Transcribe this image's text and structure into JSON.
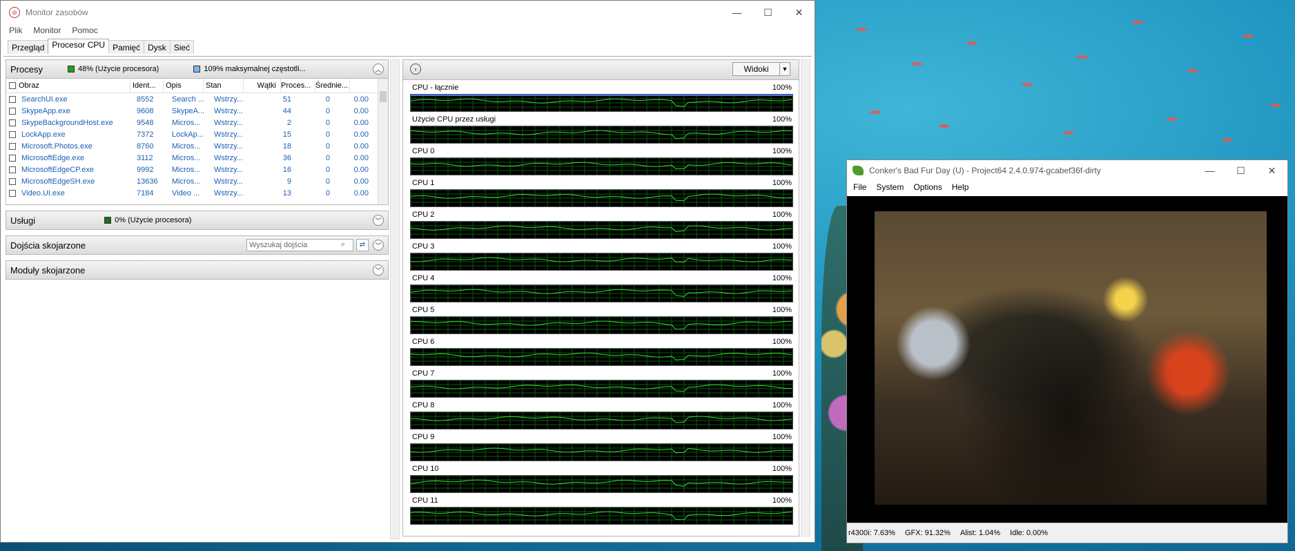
{
  "rm": {
    "title": "Monitor zasobów",
    "menu": [
      "Plik",
      "Monitor",
      "Pomoc"
    ],
    "tabs": [
      "Przegląd",
      "Procesor CPU",
      "Pamięć",
      "Dysk",
      "Sieć"
    ],
    "active_tab": "Procesor CPU",
    "processes": {
      "title": "Procesy",
      "cpu_usage": "48% (Użycie procesora)",
      "max_freq": "109% maksymalnej częstotli...",
      "columns": [
        "Obraz",
        "Ident...",
        "Opis",
        "Stan",
        "Wątki",
        "Proces...",
        "Średnie..."
      ],
      "rows": [
        [
          "SearchUI.exe",
          "8552",
          "Search ...",
          "Wstrzy...",
          "51",
          "0",
          "0.00"
        ],
        [
          "SkypeApp.exe",
          "9608",
          "SkypeA...",
          "Wstrzy...",
          "44",
          "0",
          "0.00"
        ],
        [
          "SkypeBackgroundHost.exe",
          "9548",
          "Micros...",
          "Wstrzy...",
          "2",
          "0",
          "0.00"
        ],
        [
          "LockApp.exe",
          "7372",
          "LockAp...",
          "Wstrzy...",
          "15",
          "0",
          "0.00"
        ],
        [
          "Microsoft.Photos.exe",
          "8760",
          "Micros...",
          "Wstrzy...",
          "18",
          "0",
          "0.00"
        ],
        [
          "MicrosoftEdge.exe",
          "3112",
          "Micros...",
          "Wstrzy...",
          "36",
          "0",
          "0.00"
        ],
        [
          "MicrosoftEdgeCP.exe",
          "9992",
          "Micros...",
          "Wstrzy...",
          "16",
          "0",
          "0.00"
        ],
        [
          "MicrosoftEdgeSH.exe",
          "13636",
          "Micros...",
          "Wstrzy...",
          "9",
          "0",
          "0.00"
        ],
        [
          "Video.UI.exe",
          "7184",
          "Video ...",
          "Wstrzy...",
          "13",
          "0",
          "0.00"
        ]
      ]
    },
    "services": {
      "title": "Usługi",
      "cpu_usage": "0% (Użycie procesora)"
    },
    "handles": {
      "title": "Dojścia skojarzone",
      "search_placeholder": "Wyszukaj dojścia"
    },
    "modules": {
      "title": "Moduły skojarzone"
    },
    "views_label": "Widoki",
    "graphs": [
      {
        "label": "CPU - łącznie",
        "max": "100%"
      },
      {
        "label": "Użycie CPU przez usługi",
        "max": "100%"
      },
      {
        "label": "CPU 0",
        "max": "100%"
      },
      {
        "label": "CPU 1",
        "max": "100%"
      },
      {
        "label": "CPU 2",
        "max": "100%"
      },
      {
        "label": "CPU 3",
        "max": "100%"
      },
      {
        "label": "CPU 4",
        "max": "100%"
      },
      {
        "label": "CPU 5",
        "max": "100%"
      },
      {
        "label": "CPU 6",
        "max": "100%"
      },
      {
        "label": "CPU 7",
        "max": "100%"
      },
      {
        "label": "CPU 8",
        "max": "100%"
      },
      {
        "label": "CPU 9",
        "max": "100%"
      },
      {
        "label": "CPU 10",
        "max": "100%"
      },
      {
        "label": "CPU 11",
        "max": "100%"
      }
    ],
    "colors": {
      "graph_line": "#33dd33",
      "graph_bg": "#000000",
      "link": "#1a5fb4"
    }
  },
  "pj": {
    "title": "Conker's Bad Fur Day (U) - Project64 2.4.0.974-gcabef36f-dirty",
    "menu": [
      "File",
      "System",
      "Options",
      "Help"
    ],
    "status": [
      "r4300i: 7.63%",
      "GFX: 91.32%",
      "Alist: 1.04%",
      "Idle: 0.00%"
    ]
  }
}
